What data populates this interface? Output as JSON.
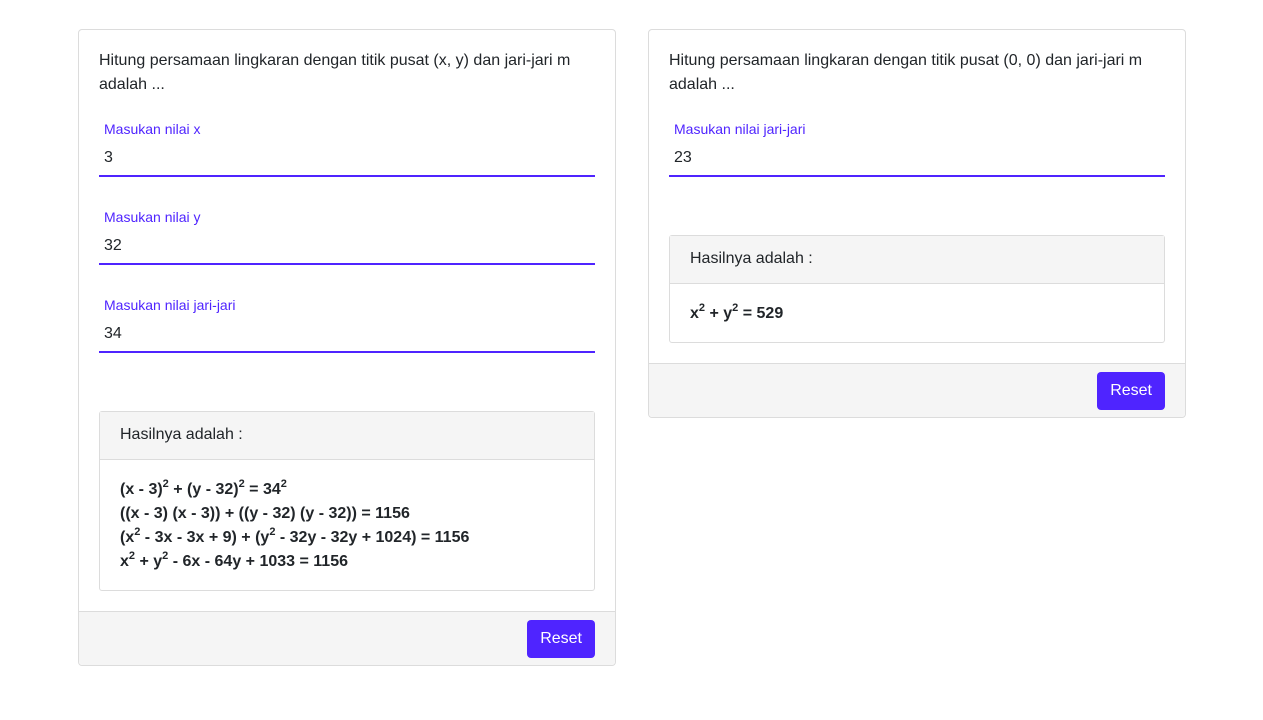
{
  "left_card": {
    "question": "Hitung persamaan lingkaran dengan titik pusat (x, y) dan jari-jari m adalah ...",
    "fields": [
      {
        "label": "Masukan nilai x",
        "value": "3"
      },
      {
        "label": "Masukan nilai y",
        "value": "32"
      },
      {
        "label": "Masukan nilai jari-jari",
        "value": "34"
      }
    ],
    "result_title": "Hasilnya adalah :",
    "eq1": {
      "a": "(x - 3)",
      "b": "2",
      "c": " + (y - 32)",
      "d": "2",
      "e": " = 34",
      "f": "2"
    },
    "eq2": {
      "a": "((x - 3) (x - 3)) + ((y - 32) (y - 32)) = 1156"
    },
    "eq3": {
      "a": "(x",
      "b": "2",
      "c": " - 3x - 3x + 9) + (y",
      "d": "2",
      "e": " - 32y - 32y + 1024) = 1156"
    },
    "eq4": {
      "a": "x",
      "b": "2",
      "c": " + y",
      "d": "2",
      "e": " - 6x - 64y + 1033 = 1156"
    },
    "reset_label": "Reset"
  },
  "right_card": {
    "question": "Hitung persamaan lingkaran dengan titik pusat (0, 0) dan jari-jari m adalah ...",
    "fields": [
      {
        "label": "Masukan nilai jari-jari",
        "value": "23"
      }
    ],
    "result_title": "Hasilnya adalah :",
    "eq1": {
      "a": "x",
      "b": "2",
      "c": " + y",
      "d": "2",
      "e": " = 529"
    },
    "reset_label": "Reset"
  },
  "colors": {
    "accent": "#4f24ff",
    "panel_bg": "#f5f5f5",
    "border": "#dcdcdc"
  }
}
